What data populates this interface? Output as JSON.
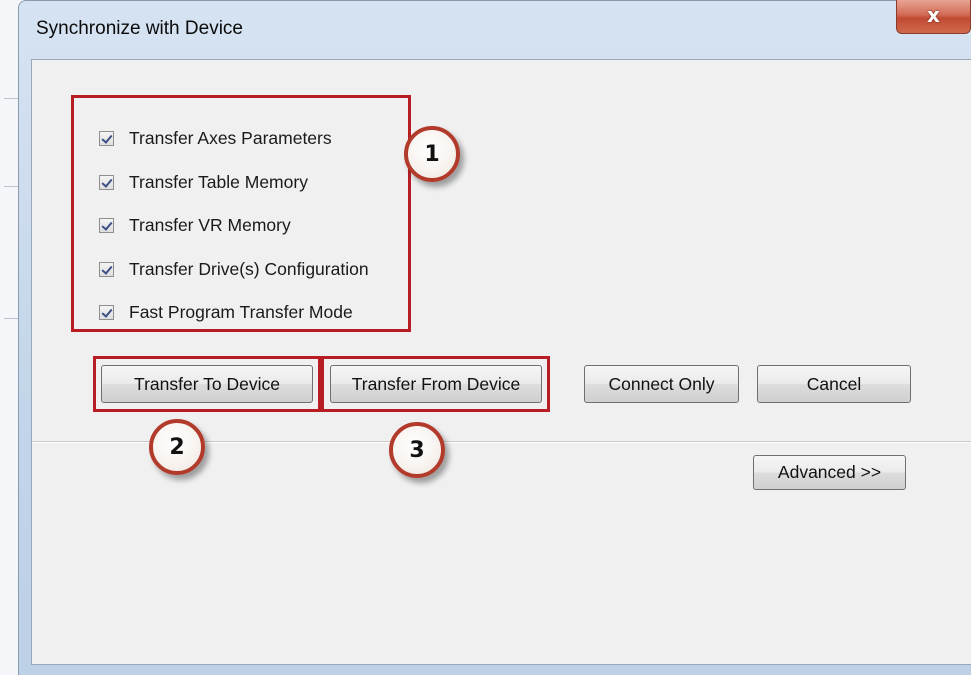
{
  "dialog": {
    "title": "Synchronize with Device",
    "close_glyph": "x"
  },
  "options": [
    {
      "label": "Transfer Axes Parameters",
      "checked": true
    },
    {
      "label": "Transfer Table Memory",
      "checked": true
    },
    {
      "label": "Transfer VR Memory",
      "checked": true
    },
    {
      "label": "Transfer Drive(s) Configuration",
      "checked": true
    },
    {
      "label": "Fast Program Transfer Mode",
      "checked": true
    }
  ],
  "buttons": {
    "transfer_to": "Transfer To Device",
    "transfer_from": "Transfer From Device",
    "connect_only": "Connect Only",
    "cancel": "Cancel",
    "advanced": "Advanced >>"
  },
  "callouts": [
    "1",
    "2",
    "3"
  ],
  "colors": {
    "annotation_red": "#b81d24",
    "close_button": "#c14a33"
  }
}
